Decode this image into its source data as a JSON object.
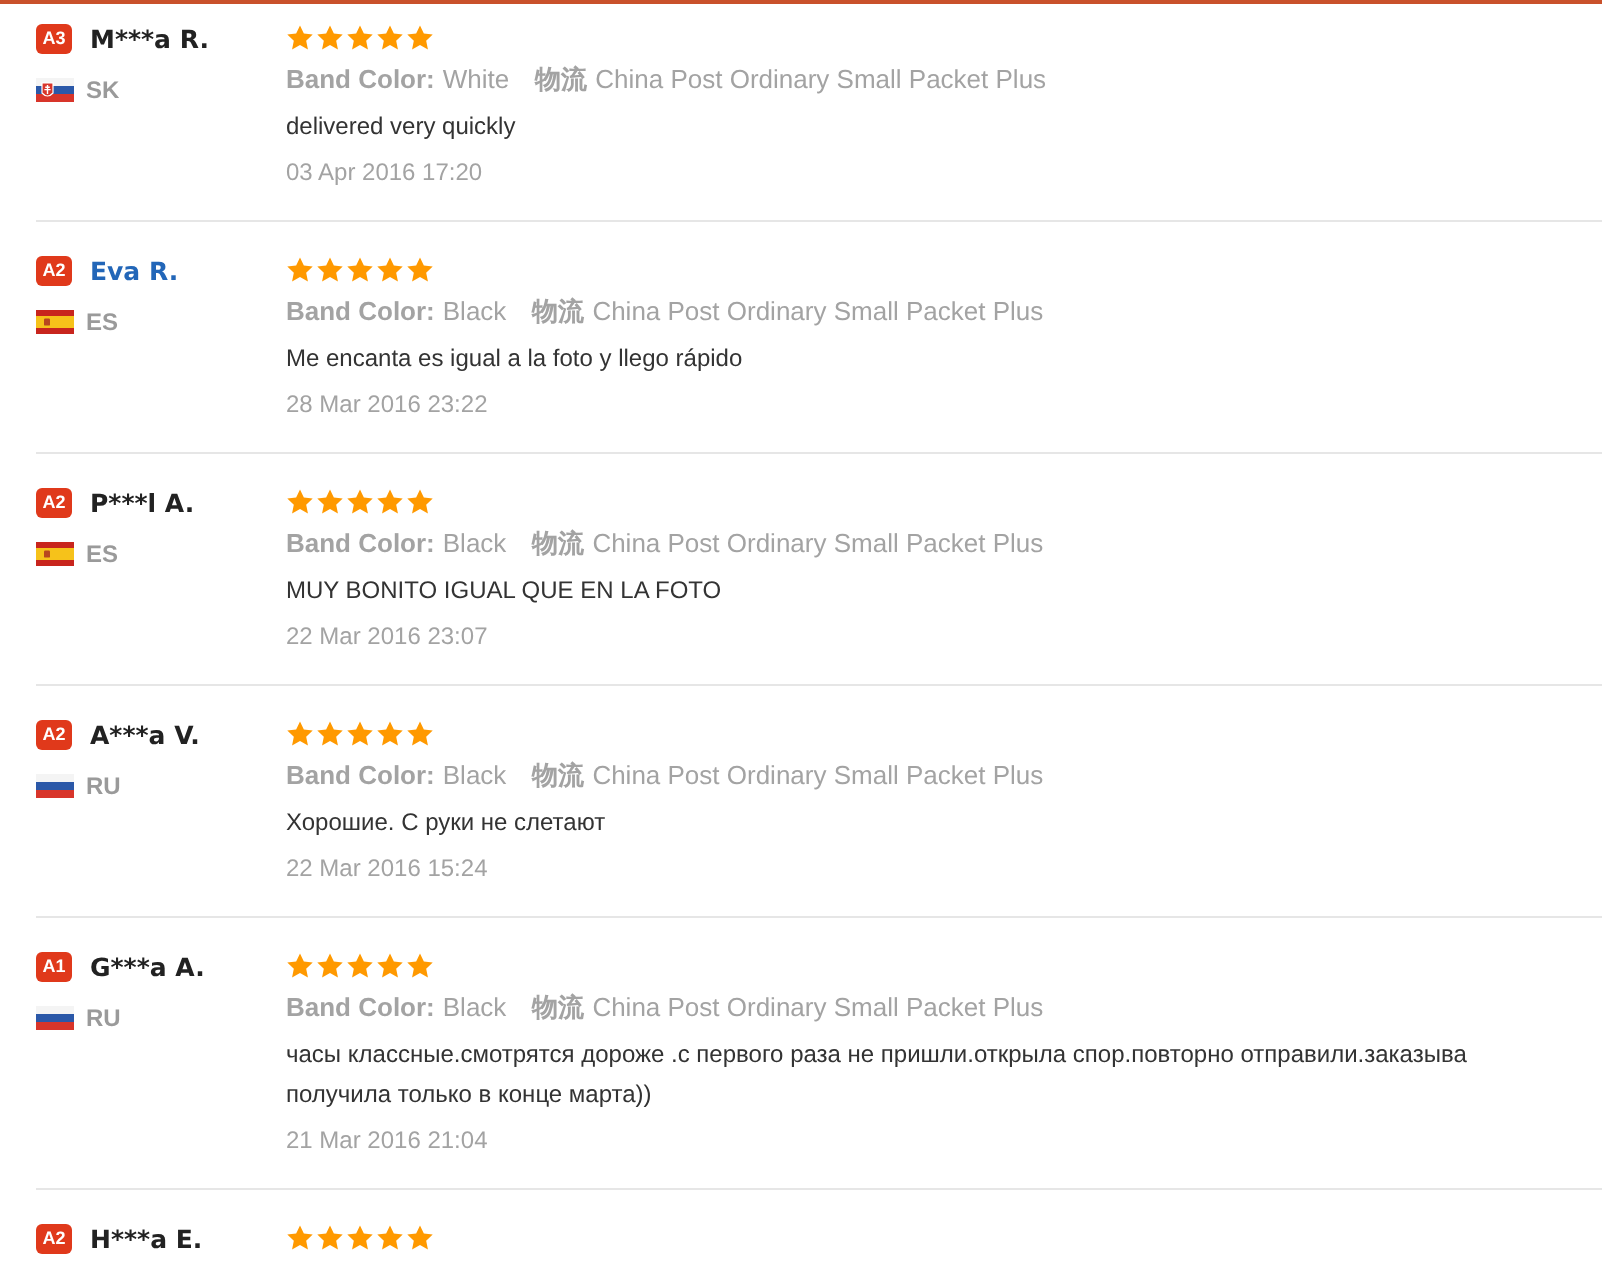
{
  "reviews": [
    {
      "rank": "A3",
      "name": "M***a R.",
      "linked": false,
      "flag": {
        "kind": "slovakia"
      },
      "country": "SK",
      "stars": 5,
      "attributes": [
        {
          "label": "Band Color:",
          "value": "White"
        },
        {
          "label": "物流",
          "value": "China Post Ordinary Small Packet Plus"
        }
      ],
      "text": "delivered very quickly",
      "date": "03 Apr 2016 17:20"
    },
    {
      "rank": "A2",
      "name": "Eva R.",
      "linked": true,
      "flag": {
        "kind": "spain"
      },
      "country": "ES",
      "stars": 5,
      "attributes": [
        {
          "label": "Band Color:",
          "value": "Black"
        },
        {
          "label": "物流",
          "value": "China Post Ordinary Small Packet Plus"
        }
      ],
      "text": "Me encanta es igual a la foto y llego rápido",
      "date": "28 Mar 2016 23:22"
    },
    {
      "rank": "A2",
      "name": "P***l A.",
      "linked": false,
      "flag": {
        "kind": "spain"
      },
      "country": "ES",
      "stars": 5,
      "attributes": [
        {
          "label": "Band Color:",
          "value": "Black"
        },
        {
          "label": "物流",
          "value": "China Post Ordinary Small Packet Plus"
        }
      ],
      "text": "MUY BONITO IGUAL QUE EN LA FOTO",
      "date": "22 Mar 2016 23:07"
    },
    {
      "rank": "A2",
      "name": "A***a V.",
      "linked": false,
      "flag": {
        "kind": "russia"
      },
      "country": "RU",
      "stars": 5,
      "attributes": [
        {
          "label": "Band Color:",
          "value": "Black"
        },
        {
          "label": "物流",
          "value": "China Post Ordinary Small Packet Plus"
        }
      ],
      "text": "Хорошие. С руки не слетают",
      "date": "22 Mar 2016 15:24"
    },
    {
      "rank": "A1",
      "name": "G***a A.",
      "linked": false,
      "flag": {
        "kind": "russia"
      },
      "country": "RU",
      "stars": 5,
      "attributes": [
        {
          "label": "Band Color:",
          "value": "Black"
        },
        {
          "label": "物流",
          "value": "China Post Ordinary Small Packet Plus"
        }
      ],
      "text": "часы классные.смотрятся дороже .с первого раза не пришли.открыла спор.повторно отправили.заказыва\nполучила только в конце марта))",
      "date": "21 Mar 2016 21:04"
    },
    {
      "rank": "A2",
      "name": "H***a E.",
      "linked": false,
      "stars": 5
    }
  ]
}
